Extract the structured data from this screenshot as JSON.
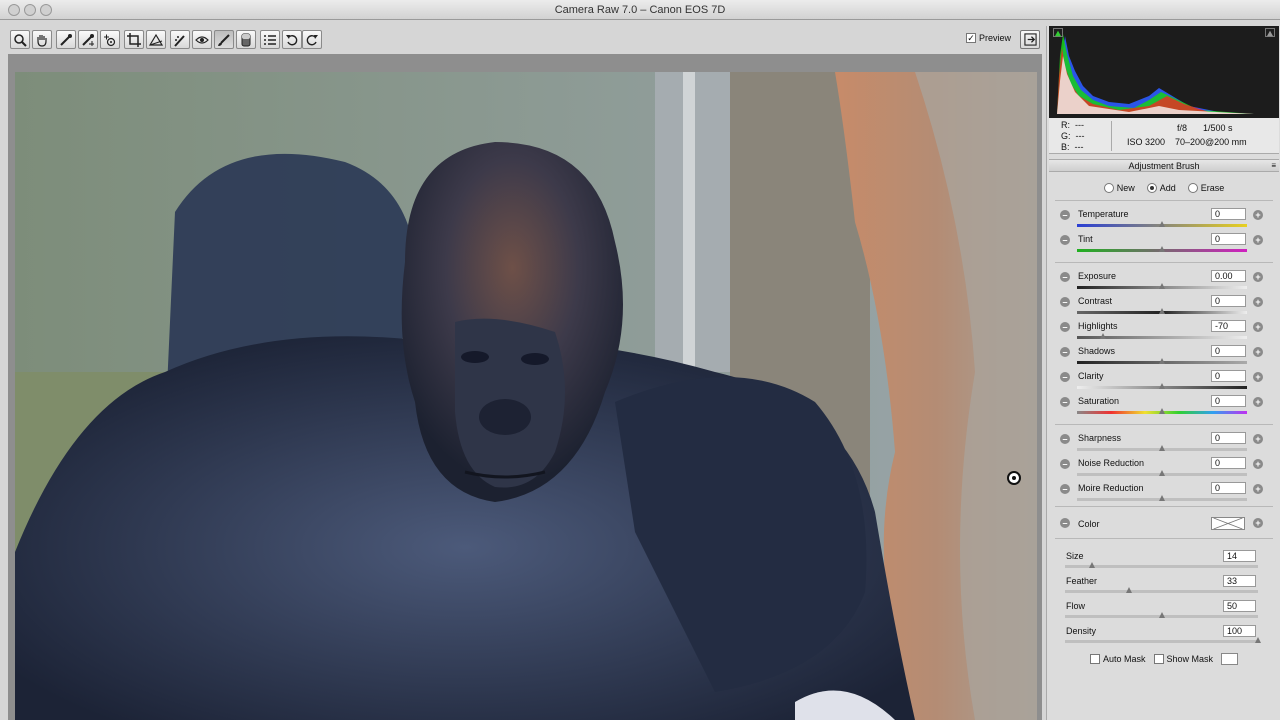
{
  "window": {
    "title": "Camera Raw 7.0  –  Canon EOS 7D"
  },
  "toolbar": {
    "tools": [
      "zoom-tool",
      "hand-tool",
      "white-balance-tool",
      "color-sampler-tool",
      "targeted-adjustment-tool",
      "crop-tool",
      "straighten-tool",
      "spot-removal-tool",
      "red-eye-tool",
      "adjustment-brush-tool",
      "graduated-filter-tool",
      "preferences",
      "rotate-ccw",
      "rotate-cw"
    ],
    "active_tool": "adjustment-brush-tool",
    "preview_label": "Preview",
    "preview_checked": true
  },
  "readout": {
    "r_label": "R:",
    "g_label": "G:",
    "b_label": "B:",
    "r": "---",
    "g": "---",
    "b": "---",
    "aperture": "f/8",
    "shutter": "1/500 s",
    "iso": "ISO 3200",
    "lens": "70–200@200 mm"
  },
  "panel": {
    "title": "Adjustment Brush",
    "modes": {
      "new": "New",
      "add": "Add",
      "erase": "Erase",
      "selected": "Add"
    },
    "sliders": [
      {
        "label": "Temperature",
        "value": "0",
        "position": 0.5
      },
      {
        "label": "Tint",
        "value": "0",
        "position": 0.5
      },
      {
        "label": "Exposure",
        "value": "0.00",
        "position": 0.5
      },
      {
        "label": "Contrast",
        "value": "0",
        "position": 0.5
      },
      {
        "label": "Highlights",
        "value": "-70",
        "position": 0.15
      },
      {
        "label": "Shadows",
        "value": "0",
        "position": 0.5
      },
      {
        "label": "Clarity",
        "value": "0",
        "position": 0.5
      },
      {
        "label": "Saturation",
        "value": "0",
        "position": 0.5
      },
      {
        "label": "Sharpness",
        "value": "0",
        "position": 0.5
      },
      {
        "label": "Noise Reduction",
        "value": "0",
        "position": 0.5
      },
      {
        "label": "Moire Reduction",
        "value": "0",
        "position": 0.5
      }
    ],
    "color_label": "Color",
    "brush": [
      {
        "label": "Size",
        "value": "14",
        "position": 0.14
      },
      {
        "label": "Feather",
        "value": "33",
        "position": 0.33
      },
      {
        "label": "Flow",
        "value": "50",
        "position": 0.5
      },
      {
        "label": "Density",
        "value": "100",
        "position": 1.0
      }
    ],
    "auto_mask_label": "Auto Mask",
    "show_mask_label": "Show Mask"
  },
  "colors": {
    "accent": "#6aa0e8",
    "panel_bg": "#dcdcdc"
  }
}
